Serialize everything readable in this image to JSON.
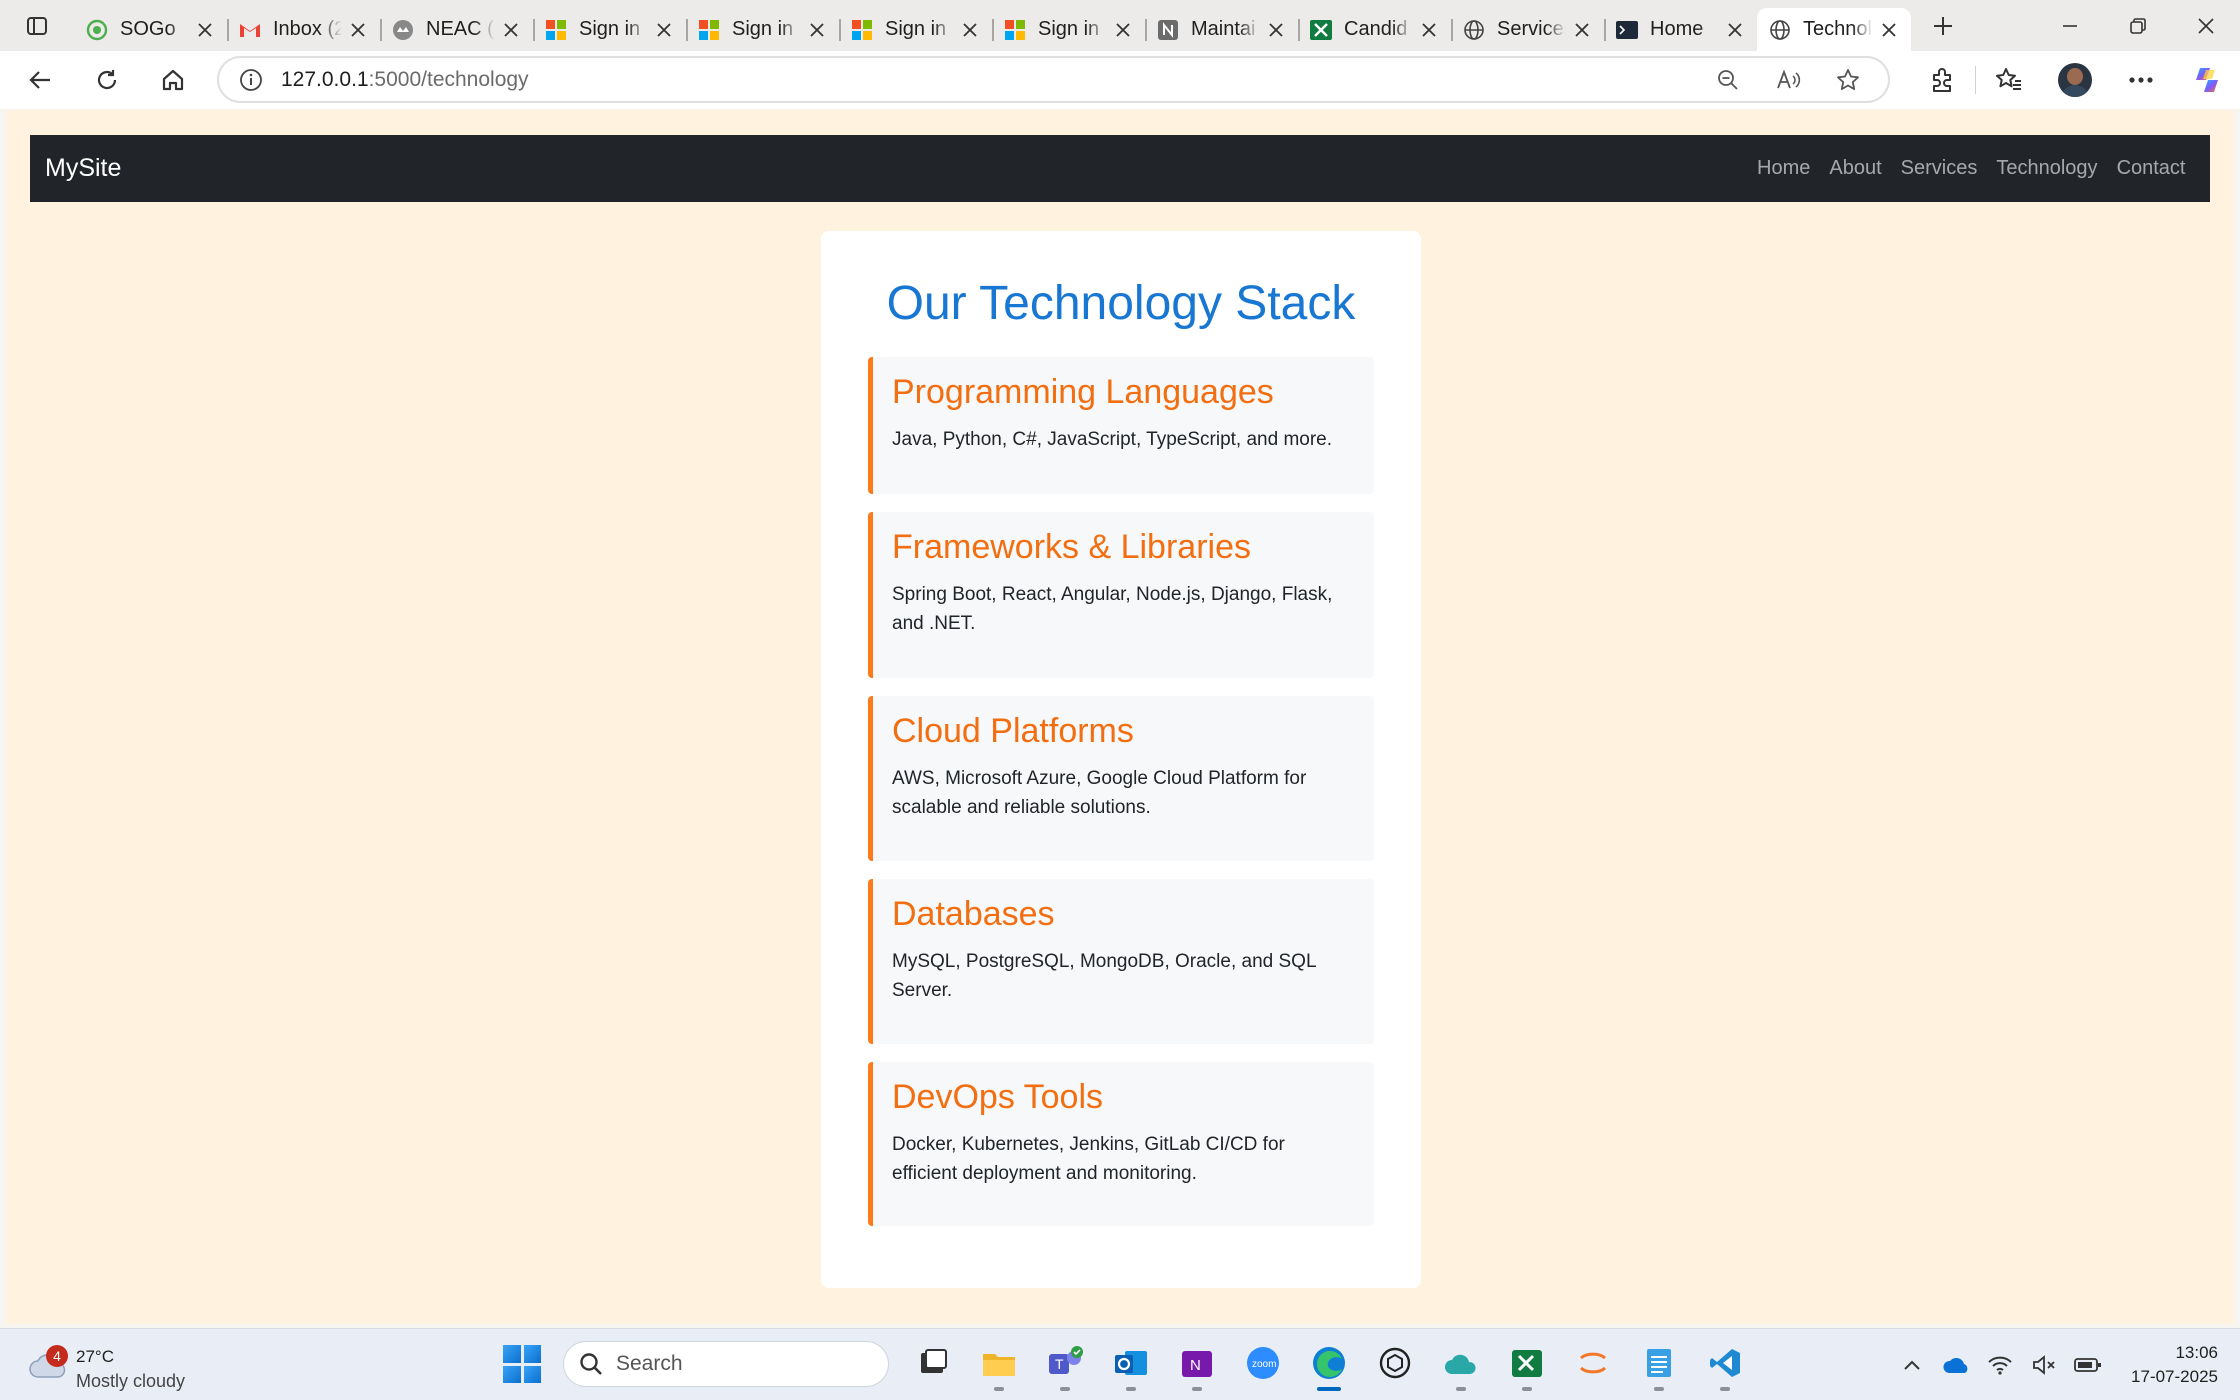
{
  "browser": {
    "tabs": [
      {
        "title": "SOGo",
        "icon": "sogo-icon",
        "color": "#4caf50"
      },
      {
        "title": "Inbox (2",
        "icon": "gmail-icon",
        "color": "#ea4335"
      },
      {
        "title": "NEAC (I",
        "icon": "neac-icon",
        "color": "#888888"
      },
      {
        "title": "Sign in",
        "icon": "microsoft-icon",
        "color": "#f25022"
      },
      {
        "title": "Sign in",
        "icon": "microsoft-icon",
        "color": "#f25022"
      },
      {
        "title": "Sign in",
        "icon": "microsoft-icon",
        "color": "#f25022"
      },
      {
        "title": "Sign in",
        "icon": "microsoft-icon",
        "color": "#f25022"
      },
      {
        "title": "Maintai",
        "icon": "notion-icon",
        "color": "#6b6b6b"
      },
      {
        "title": "Candid",
        "icon": "excel-icon",
        "color": "#107c41"
      },
      {
        "title": "Services",
        "icon": "globe-icon",
        "color": "#444444"
      },
      {
        "title": "Home",
        "icon": "terminal-icon",
        "color": "#1e2a3a"
      },
      {
        "title": "Technol",
        "icon": "globe-icon",
        "color": "#444444",
        "active": true
      }
    ],
    "url": {
      "host": "127.0.0.1",
      "rest": ":5000/technology"
    }
  },
  "site": {
    "brand": "MySite",
    "nav": [
      "Home",
      "About",
      "Services",
      "Technology",
      "Contact"
    ],
    "colors": {
      "navbar": "#212529",
      "heading": "#1877d2",
      "accent": "#f26e10",
      "page_bg": "#fff3e0"
    }
  },
  "main": {
    "title": "Our Technology Stack",
    "sections": [
      {
        "heading": "Programming Languages",
        "text": "Java, Python, C#, JavaScript, TypeScript, and more."
      },
      {
        "heading": "Frameworks & Libraries",
        "text": "Spring Boot, React, Angular, Node.js, Django, Flask, and .NET."
      },
      {
        "heading": "Cloud Platforms",
        "text": "AWS, Microsoft Azure, Google Cloud Platform for scalable and reliable solutions."
      },
      {
        "heading": "Databases",
        "text": "MySQL, PostgreSQL, MongoDB, Oracle, and SQL Server."
      },
      {
        "heading": "DevOps Tools",
        "text": "Docker, Kubernetes, Jenkins, GitLab CI/CD for efficient deployment and monitoring."
      }
    ]
  },
  "taskbar": {
    "weather": {
      "badge": "4",
      "temp": "27°C",
      "condition": "Mostly cloudy"
    },
    "search_placeholder": "Search",
    "apps": [
      "task-view-icon",
      "file-explorer-icon",
      "teams-icon",
      "outlook-icon",
      "onenote-icon",
      "zoom-icon",
      "edge-icon",
      "chatgpt-icon",
      "cloud-app-icon",
      "excel-icon",
      "jupyter-icon",
      "notepad-icon",
      "vscode-icon"
    ],
    "time": "13:06",
    "date": "17-07-2025"
  }
}
